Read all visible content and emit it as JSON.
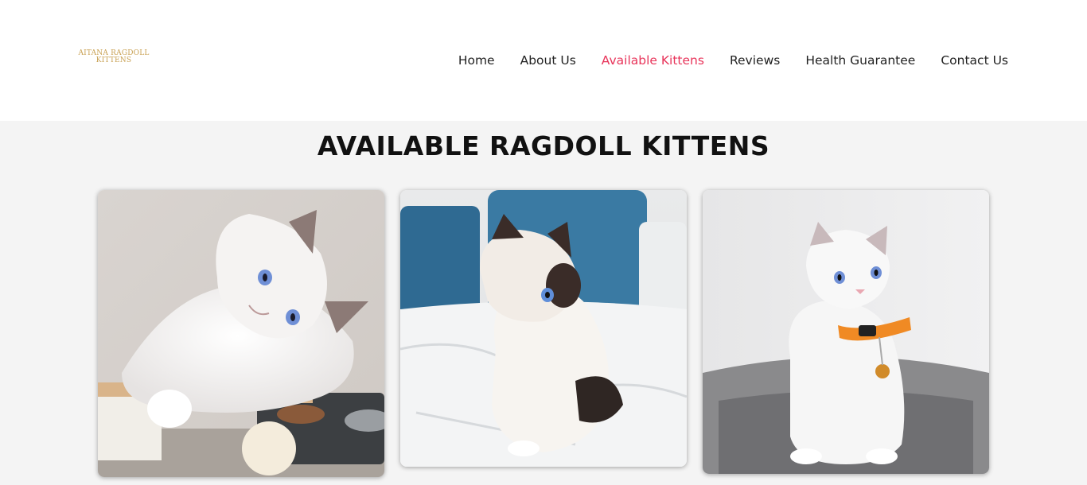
{
  "logo": {
    "line1": "AITANA RAGDOLL",
    "line2": "KITTENS",
    "color": "#c8a052"
  },
  "nav": {
    "items": [
      {
        "label": "Home",
        "active": false
      },
      {
        "label": "About Us",
        "active": false
      },
      {
        "label": "Available Kittens",
        "active": true
      },
      {
        "label": "Reviews",
        "active": false
      },
      {
        "label": "Health Guarantee",
        "active": false
      },
      {
        "label": "Contact Us",
        "active": false
      }
    ],
    "active_color": "#e8345a",
    "text_color": "#222222"
  },
  "main": {
    "title": "AVAILABLE RAGDOLL KITTENS",
    "kittens": [
      {
        "photo": "blue-point ragdoll kitten lying on cat shelf"
      },
      {
        "photo": "seal-point ragdoll kitten sitting on white bed with blue pillows"
      },
      {
        "photo": "white ragdoll kitten with orange collar in grey cat bed"
      }
    ]
  },
  "colors": {
    "background": "#f4f4f4",
    "header": "#ffffff",
    "title": "#111111"
  }
}
